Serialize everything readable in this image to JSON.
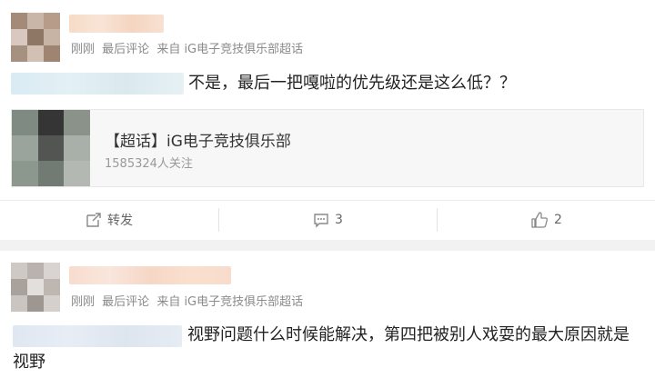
{
  "posts": [
    {
      "meta": {
        "time": "刚刚",
        "type": "最后评论",
        "source": "来自 iG电子竞技俱乐部超话"
      },
      "text": "不是，最后一把嘎啦的优先级还是这么低？？",
      "card": {
        "title": "【超话】iG电子竞技俱乐部",
        "followers": "1585324人关注"
      },
      "actions": {
        "repost": "转发",
        "comments": "3",
        "likes": "2"
      }
    },
    {
      "meta": {
        "time": "刚刚",
        "type": "最后评论",
        "source": "来自 iG电子竞技俱乐部超话"
      },
      "text": "视野问题什么时候能解决，第四把被别人戏耍的最大原因就是视野"
    }
  ],
  "icons": {
    "repost": "repost-icon",
    "comment": "comment-icon",
    "like": "thumbs-up-icon"
  },
  "colors": {
    "background": "#ffffff",
    "separator": "#f2f2f2",
    "meta": "#8a8a8a"
  }
}
